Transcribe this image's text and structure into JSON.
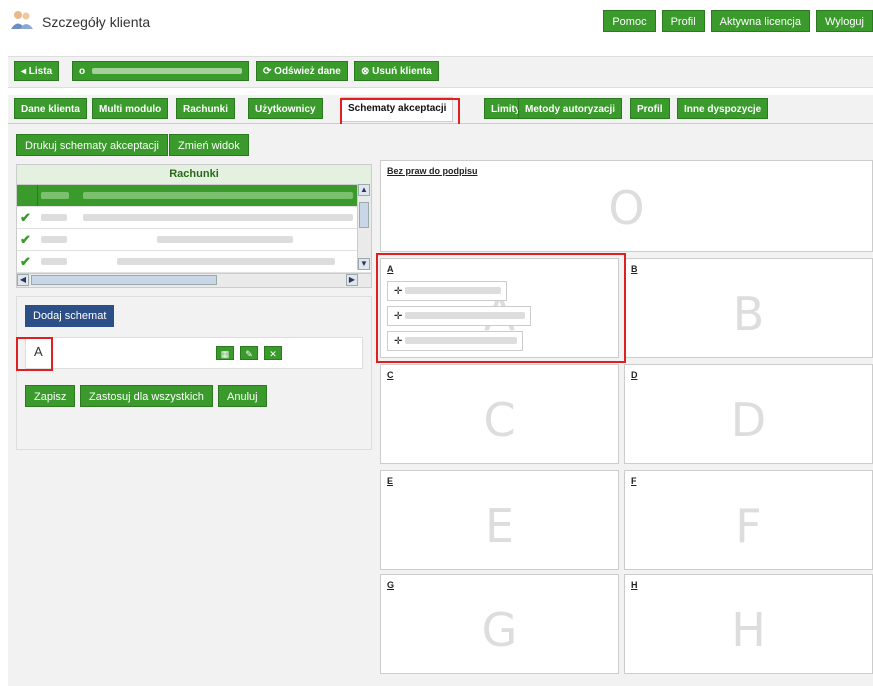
{
  "header": {
    "title": "Szczegóły klienta",
    "buttons": [
      "Pomoc",
      "Profil",
      "Aktywna licencja",
      "Wyloguj"
    ]
  },
  "toolbar": {
    "list_label": "◂ Lista",
    "client_prefix": "o",
    "refresh_label": "Odśwież dane",
    "delete_label": "Usuń klienta"
  },
  "tabs": [
    "Dane klienta",
    "Multi modulo",
    "Rachunki",
    "Użytkownicy",
    "Schematy akceptacji",
    "Limity",
    "Metody autoryzacji",
    "Profil",
    "Inne dyspozycje"
  ],
  "actions": {
    "print_label": "Drukuj schematy akceptacji",
    "change_view_label": "Zmień widok"
  },
  "accounts_table": {
    "header": "Rachunki"
  },
  "scheme_form": {
    "add_label": "Dodaj schemat",
    "scheme_name": "A",
    "save_label": "Zapisz",
    "apply_all_label": "Zastosuj dla wszystkich",
    "cancel_label": "Anuluj"
  },
  "groups": {
    "none_label": "Bez praw do podpisu",
    "none_letter": "O",
    "cells": [
      {
        "label": "A",
        "letter": "A"
      },
      {
        "label": "B",
        "letter": "B"
      },
      {
        "label": "C",
        "letter": "C"
      },
      {
        "label": "D",
        "letter": "D"
      },
      {
        "label": "E",
        "letter": "E"
      },
      {
        "label": "F",
        "letter": "F"
      },
      {
        "label": "G",
        "letter": "G"
      },
      {
        "label": "H",
        "letter": "H"
      }
    ]
  },
  "colors": {
    "brand_green": "#3a9a2c",
    "highlight_red": "#e02020",
    "button_blue": "#2b4f86"
  }
}
